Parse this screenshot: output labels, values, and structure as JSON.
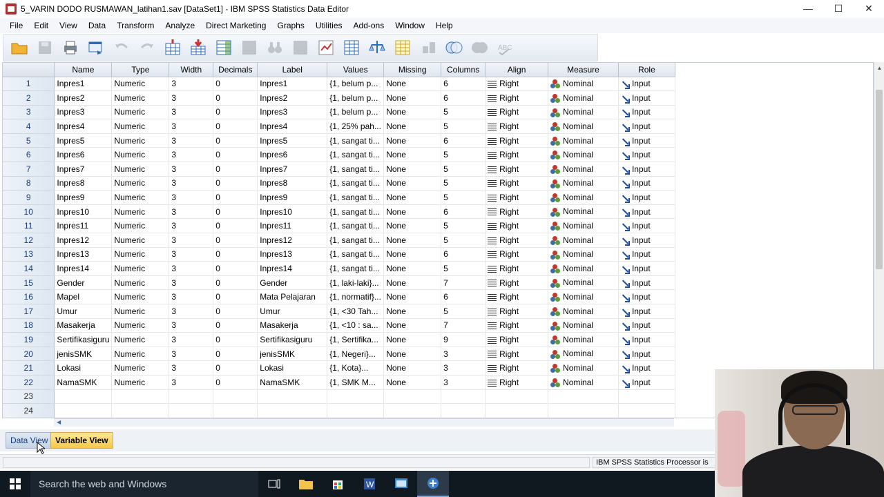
{
  "window": {
    "title": "5_VARIN DODO RUSMAWAN_latihan1.sav [DataSet1] - IBM SPSS Statistics Data Editor",
    "minimize": "—",
    "maximize": "☐",
    "close": "✕"
  },
  "menu": [
    "File",
    "Edit",
    "View",
    "Data",
    "Transform",
    "Analyze",
    "Direct Marketing",
    "Graphs",
    "Utilities",
    "Add-ons",
    "Window",
    "Help"
  ],
  "columns": [
    "Name",
    "Type",
    "Width",
    "Decimals",
    "Label",
    "Values",
    "Missing",
    "Columns",
    "Align",
    "Measure",
    "Role"
  ],
  "rows": [
    {
      "num": "1",
      "name": "Inpres1",
      "type": "Numeric",
      "width": "3",
      "decimals": "0",
      "label": "Inpres1",
      "values": "{1, belum p...",
      "missing": "None",
      "columns": "6",
      "align": "Right",
      "measure": "Nominal",
      "role": "Input"
    },
    {
      "num": "2",
      "name": "Inpres2",
      "type": "Numeric",
      "width": "3",
      "decimals": "0",
      "label": "Inpres2",
      "values": "{1, belum p...",
      "missing": "None",
      "columns": "6",
      "align": "Right",
      "measure": "Nominal",
      "role": "Input"
    },
    {
      "num": "3",
      "name": "Inpres3",
      "type": "Numeric",
      "width": "3",
      "decimals": "0",
      "label": "Inpres3",
      "values": "{1, belum p...",
      "missing": "None",
      "columns": "5",
      "align": "Right",
      "measure": "Nominal",
      "role": "Input"
    },
    {
      "num": "4",
      "name": "Inpres4",
      "type": "Numeric",
      "width": "3",
      "decimals": "0",
      "label": "Inpres4",
      "values": "{1, 25% pah...",
      "missing": "None",
      "columns": "5",
      "align": "Right",
      "measure": "Nominal",
      "role": "Input"
    },
    {
      "num": "5",
      "name": "Inpres5",
      "type": "Numeric",
      "width": "3",
      "decimals": "0",
      "label": "Inpres5",
      "values": "{1, sangat ti...",
      "missing": "None",
      "columns": "6",
      "align": "Right",
      "measure": "Nominal",
      "role": "Input"
    },
    {
      "num": "6",
      "name": "Inpres6",
      "type": "Numeric",
      "width": "3",
      "decimals": "0",
      "label": "Inpres6",
      "values": "{1, sangat ti...",
      "missing": "None",
      "columns": "5",
      "align": "Right",
      "measure": "Nominal",
      "role": "Input"
    },
    {
      "num": "7",
      "name": "Inpres7",
      "type": "Numeric",
      "width": "3",
      "decimals": "0",
      "label": "Inpres7",
      "values": "{1, sangat ti...",
      "missing": "None",
      "columns": "5",
      "align": "Right",
      "measure": "Nominal",
      "role": "Input"
    },
    {
      "num": "8",
      "name": "Inpres8",
      "type": "Numeric",
      "width": "3",
      "decimals": "0",
      "label": "Inpres8",
      "values": "{1, sangat ti...",
      "missing": "None",
      "columns": "5",
      "align": "Right",
      "measure": "Nominal",
      "role": "Input"
    },
    {
      "num": "9",
      "name": "Inpres9",
      "type": "Numeric",
      "width": "3",
      "decimals": "0",
      "label": "Inpres9",
      "values": "{1, sangat ti...",
      "missing": "None",
      "columns": "5",
      "align": "Right",
      "measure": "Nominal",
      "role": "Input"
    },
    {
      "num": "10",
      "name": "Inpres10",
      "type": "Numeric",
      "width": "3",
      "decimals": "0",
      "label": "Inpres10",
      "values": "{1, sangat ti...",
      "missing": "None",
      "columns": "6",
      "align": "Right",
      "measure": "Nominal",
      "role": "Input"
    },
    {
      "num": "11",
      "name": "Inpres11",
      "type": "Numeric",
      "width": "3",
      "decimals": "0",
      "label": "Inpres11",
      "values": "{1, sangat ti...",
      "missing": "None",
      "columns": "5",
      "align": "Right",
      "measure": "Nominal",
      "role": "Input"
    },
    {
      "num": "12",
      "name": "Inpres12",
      "type": "Numeric",
      "width": "3",
      "decimals": "0",
      "label": "Inpres12",
      "values": "{1, sangat ti...",
      "missing": "None",
      "columns": "5",
      "align": "Right",
      "measure": "Nominal",
      "role": "Input"
    },
    {
      "num": "13",
      "name": "Inpres13",
      "type": "Numeric",
      "width": "3",
      "decimals": "0",
      "label": "Inpres13",
      "values": "{1, sangat ti...",
      "missing": "None",
      "columns": "6",
      "align": "Right",
      "measure": "Nominal",
      "role": "Input"
    },
    {
      "num": "14",
      "name": "Inpres14",
      "type": "Numeric",
      "width": "3",
      "decimals": "0",
      "label": "Inpres14",
      "values": "{1, sangat ti...",
      "missing": "None",
      "columns": "5",
      "align": "Right",
      "measure": "Nominal",
      "role": "Input"
    },
    {
      "num": "15",
      "name": "Gender",
      "type": "Numeric",
      "width": "3",
      "decimals": "0",
      "label": "Gender",
      "values": "{1, laki-laki}...",
      "missing": "None",
      "columns": "7",
      "align": "Right",
      "measure": "Nominal",
      "role": "Input"
    },
    {
      "num": "16",
      "name": "Mapel",
      "type": "Numeric",
      "width": "3",
      "decimals": "0",
      "label": "Mata Pelajaran",
      "values": "{1, normatif}...",
      "missing": "None",
      "columns": "6",
      "align": "Right",
      "measure": "Nominal",
      "role": "Input"
    },
    {
      "num": "17",
      "name": "Umur",
      "type": "Numeric",
      "width": "3",
      "decimals": "0",
      "label": "Umur",
      "values": "{1, <30 Tah...",
      "missing": "None",
      "columns": "5",
      "align": "Right",
      "measure": "Nominal",
      "role": "Input"
    },
    {
      "num": "18",
      "name": "Masakerja",
      "type": "Numeric",
      "width": "3",
      "decimals": "0",
      "label": "Masakerja",
      "values": "{1, <10 : sa...",
      "missing": "None",
      "columns": "7",
      "align": "Right",
      "measure": "Nominal",
      "role": "Input"
    },
    {
      "num": "19",
      "name": "Sertifikasiguru",
      "type": "Numeric",
      "width": "3",
      "decimals": "0",
      "label": "Sertifikasiguru",
      "values": "{1, Sertifika...",
      "missing": "None",
      "columns": "9",
      "align": "Right",
      "measure": "Nominal",
      "role": "Input"
    },
    {
      "num": "20",
      "name": "jenisSMK",
      "type": "Numeric",
      "width": "3",
      "decimals": "0",
      "label": "jenisSMK",
      "values": "{1, Negeri}...",
      "missing": "None",
      "columns": "3",
      "align": "Right",
      "measure": "Nominal",
      "role": "Input"
    },
    {
      "num": "21",
      "name": "Lokasi",
      "type": "Numeric",
      "width": "3",
      "decimals": "0",
      "label": "Lokasi",
      "values": "{1, Kota}...",
      "missing": "None",
      "columns": "3",
      "align": "Right",
      "measure": "Nominal",
      "role": "Input"
    },
    {
      "num": "22",
      "name": "NamaSMK",
      "type": "Numeric",
      "width": "3",
      "decimals": "0",
      "label": "NamaSMK",
      "values": "{1, SMK M...",
      "missing": "None",
      "columns": "3",
      "align": "Right",
      "measure": "Nominal",
      "role": "Input"
    }
  ],
  "empty_rows": [
    "23",
    "24"
  ],
  "tabs": {
    "data_view": "Data View",
    "variable_view": "Variable View"
  },
  "status": {
    "processor": "IBM SPSS Statistics Processor is"
  },
  "taskbar": {
    "search_placeholder": "Search the web and Windows"
  },
  "colors": {
    "tab_active": "#f6c84a",
    "row_header_text": "#1b3c78",
    "taskbar": "#101820"
  }
}
